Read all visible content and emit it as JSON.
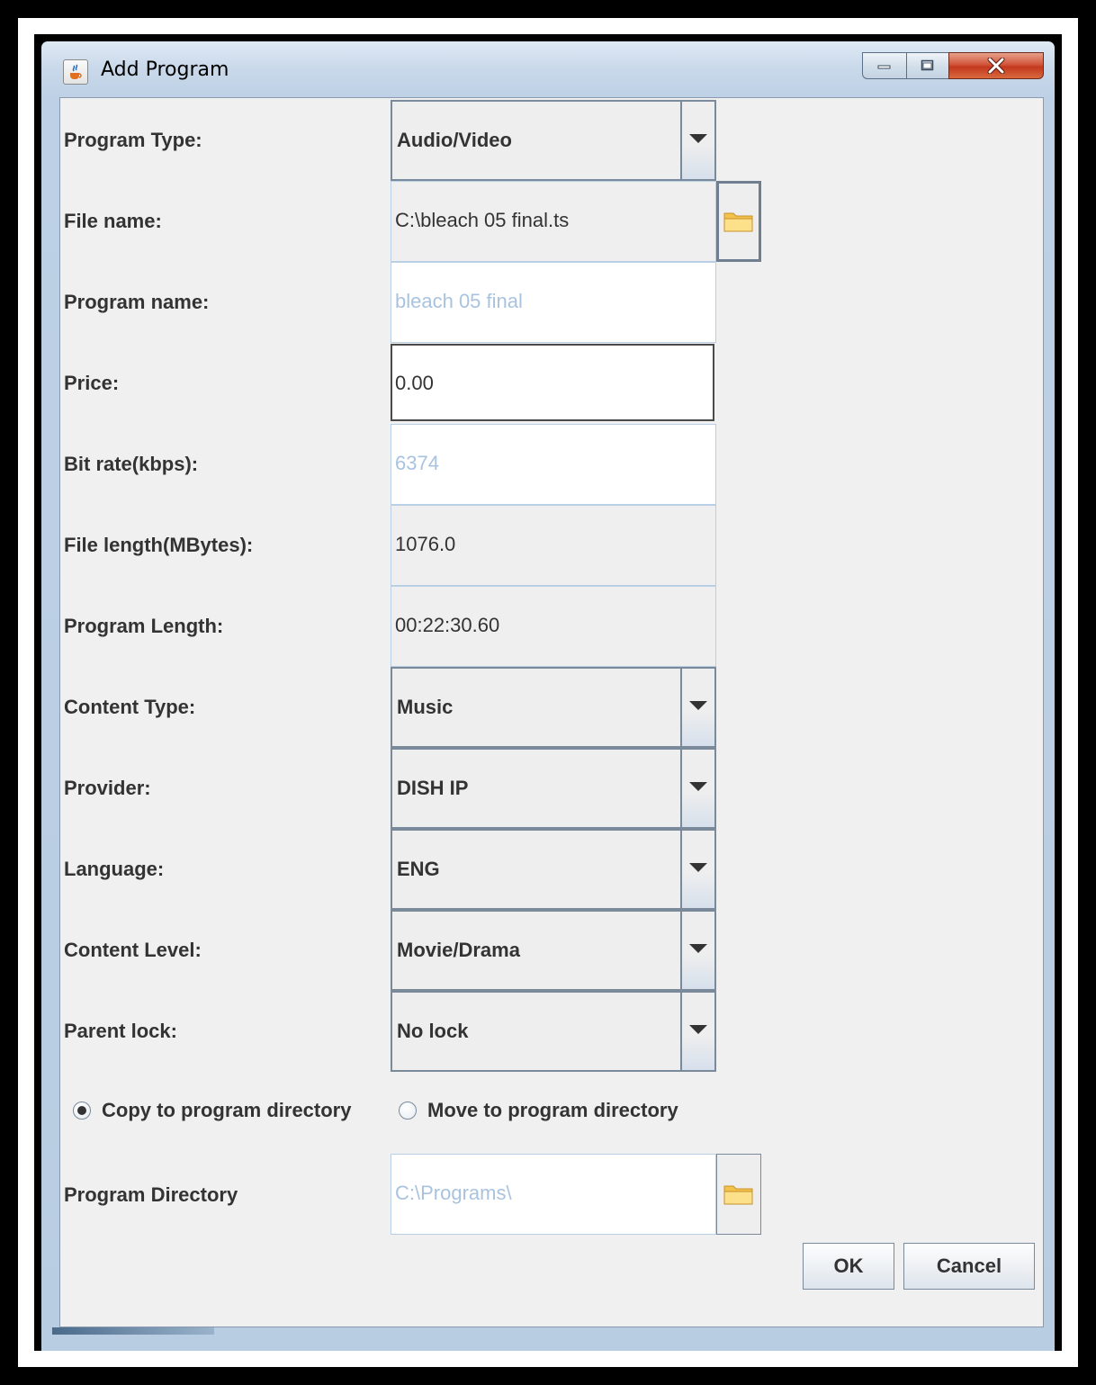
{
  "window": {
    "title": "Add Program",
    "title_icon": "java-cup-icon",
    "caption_icons": [
      "minimize-icon",
      "maximize-icon",
      "close-icon"
    ]
  },
  "fields": {
    "program_type": {
      "label": "Program Type:",
      "value": "Audio/Video"
    },
    "file_name": {
      "label": "File name:",
      "value": "C:\\bleach 05 final.ts"
    },
    "program_name": {
      "label": "Program name:",
      "value": "bleach 05 final"
    },
    "price": {
      "label": "Price:",
      "value": "0.00"
    },
    "bit_rate": {
      "label": "Bit rate(kbps):",
      "value": "6374"
    },
    "file_length": {
      "label": "File length(MBytes):",
      "value": "1076.0"
    },
    "program_length": {
      "label": "Program Length:",
      "value": "00:22:30.60"
    },
    "content_type": {
      "label": "Content Type:",
      "value": "Music"
    },
    "provider": {
      "label": "Provider:",
      "value": "DISH IP"
    },
    "language": {
      "label": "Language:",
      "value": "ENG"
    },
    "content_level": {
      "label": "Content Level:",
      "value": "Movie/Drama"
    },
    "parent_lock": {
      "label": "Parent lock:",
      "value": "No lock"
    }
  },
  "transfer_mode": {
    "copy_label": "Copy to program directory",
    "move_label": "Move to program directory",
    "selected": "copy"
  },
  "program_directory": {
    "label": "Program Directory",
    "value": "C:\\Programs\\"
  },
  "buttons": {
    "ok": "OK",
    "cancel": "Cancel"
  },
  "colors": {
    "panel_background": "#f0f0f0",
    "disabled_text": "#a9c3df",
    "label_text": "#333333",
    "close_button": "#c2381e"
  }
}
